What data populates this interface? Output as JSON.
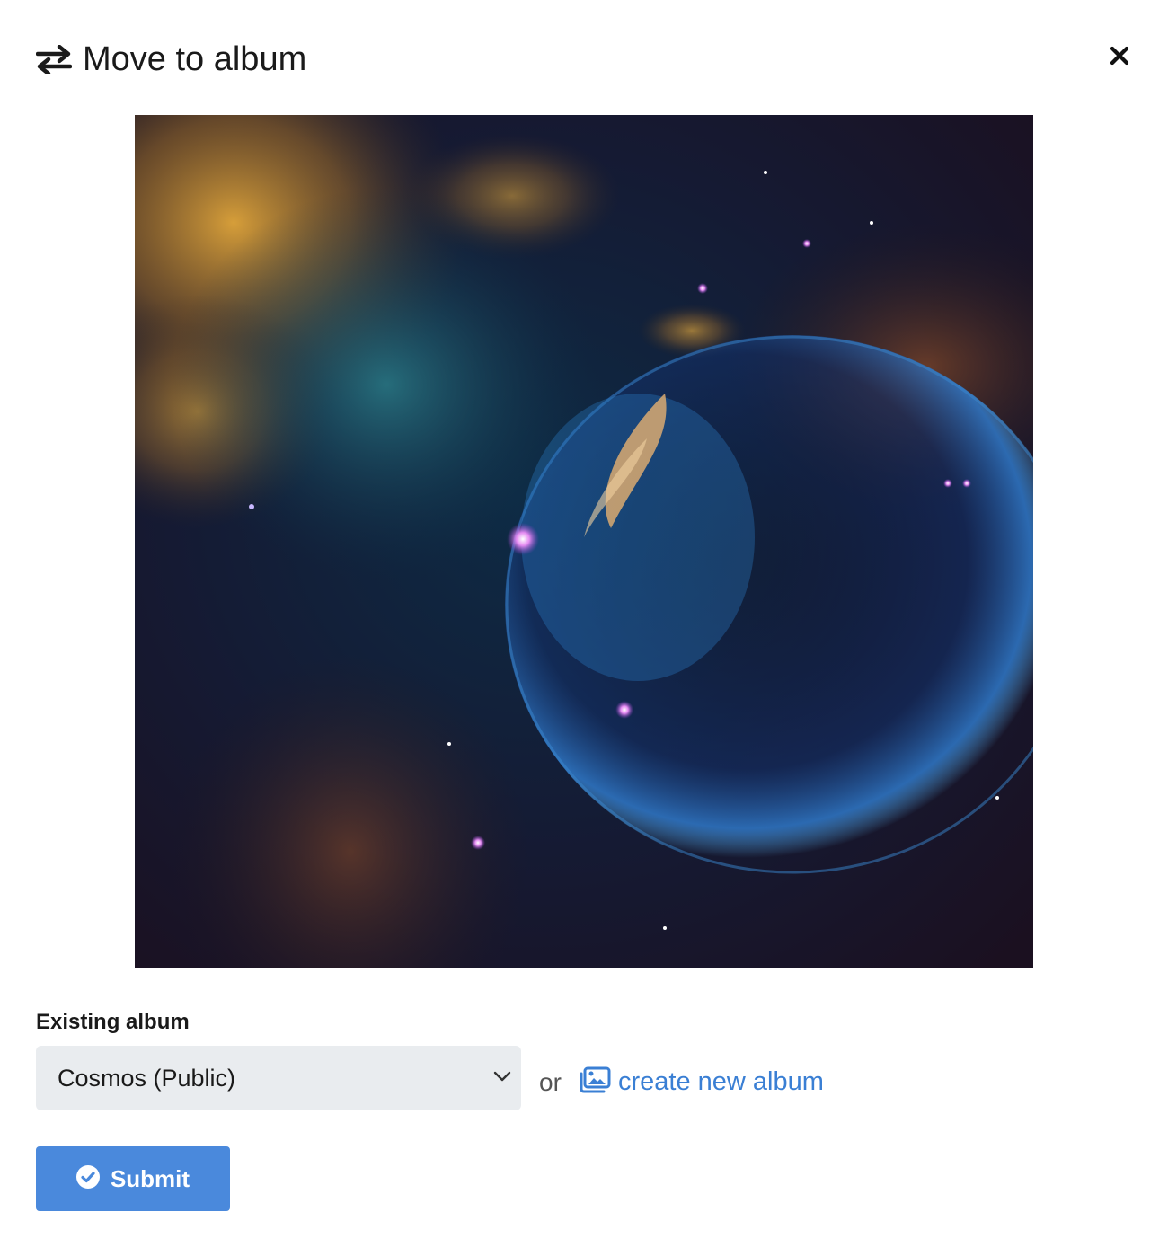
{
  "dialog": {
    "title": "Move to album",
    "title_icon": "exchange-arrows-icon",
    "close_icon": "close-icon"
  },
  "preview": {
    "icon": "nebula-photo"
  },
  "form": {
    "existing_album_label": "Existing album",
    "album_select": {
      "selected": "Cosmos (Public)",
      "icon": "chevron-down-icon"
    },
    "or_text": "or",
    "create_album_link": {
      "label": "create new album",
      "icon": "images-icon"
    },
    "submit": {
      "label": "Submit",
      "icon": "check-circle-icon"
    }
  },
  "colors": {
    "accent": "#4a89dc",
    "link": "#3a7fd4",
    "select_bg": "#e9ecef"
  }
}
